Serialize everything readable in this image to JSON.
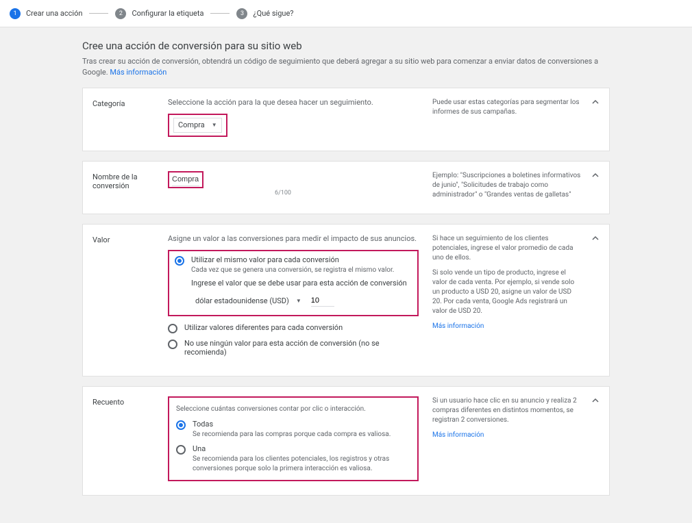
{
  "stepper": {
    "s1": {
      "num": "1",
      "label": "Crear una acción"
    },
    "s2": {
      "num": "2",
      "label": "Configurar la etiqueta"
    },
    "s3": {
      "num": "3",
      "label": "¿Qué sigue?"
    }
  },
  "page": {
    "title": "Cree una acción de conversión para su sitio web",
    "subtitle": "Tras crear su acción de conversión, obtendrá un código de seguimiento que deberá agregar a su sitio web para comenzar a enviar datos de conversiones a Google.",
    "more_info": "Más información"
  },
  "category": {
    "label": "Categoría",
    "desc": "Seleccione la acción para la que desea hacer un seguimiento.",
    "value": "Compra",
    "help": "Puede usar estas categorías para segmentar los informes de sus campañas."
  },
  "name": {
    "label": "Nombre de la conversión",
    "value": "Compra",
    "counter": "6/100",
    "help": "Ejemplo: \"Suscripciones a boletines informativos de junio\", \"Solicitudes de trabajo como administrador\" o \"Grandes ventas de galletas\""
  },
  "value": {
    "label": "Valor",
    "desc": "Asigne un valor a las conversiones para medir el impacto de sus anuncios.",
    "opt_same": "Utilizar el mismo valor para cada conversión",
    "opt_same_sub": "Cada vez que se genera una conversión, se registra el mismo valor.",
    "prompt": "Ingrese el valor que se debe usar para esta acción de conversión",
    "currency": "dólar estadounidense (USD)",
    "amount": "10",
    "opt_diff": "Utilizar valores diferentes para cada conversión",
    "opt_none": "No use ningún valor para esta acción de conversión (no se recomienda)",
    "help1": "Si hace un seguimiento de los clientes potenciales, ingrese el valor promedio de cada uno de ellos.",
    "help2": "Si solo vende un tipo de producto, ingrese el valor de cada venta. Por ejemplo, si vende solo un producto a USD 20, asigne un valor de USD 20. Por cada venta, Google Ads registrará un valor de USD 20.",
    "help_more": "Más información"
  },
  "count": {
    "label": "Recuento",
    "desc": "Seleccione cuántas conversiones contar por clic o interacción.",
    "opt_all": "Todas",
    "opt_all_sub": "Se recomienda para las compras porque cada compra es valiosa.",
    "opt_one": "Una",
    "opt_one_sub": "Se recomienda para los clientes potenciales, los registros y otras conversiones porque solo la primera interacción es valiosa.",
    "help": "Si un usuario hace clic en su anuncio y realiza 2 compras diferentes en distintos momentos, se registran 2 conversiones.",
    "help_more": "Más información"
  }
}
